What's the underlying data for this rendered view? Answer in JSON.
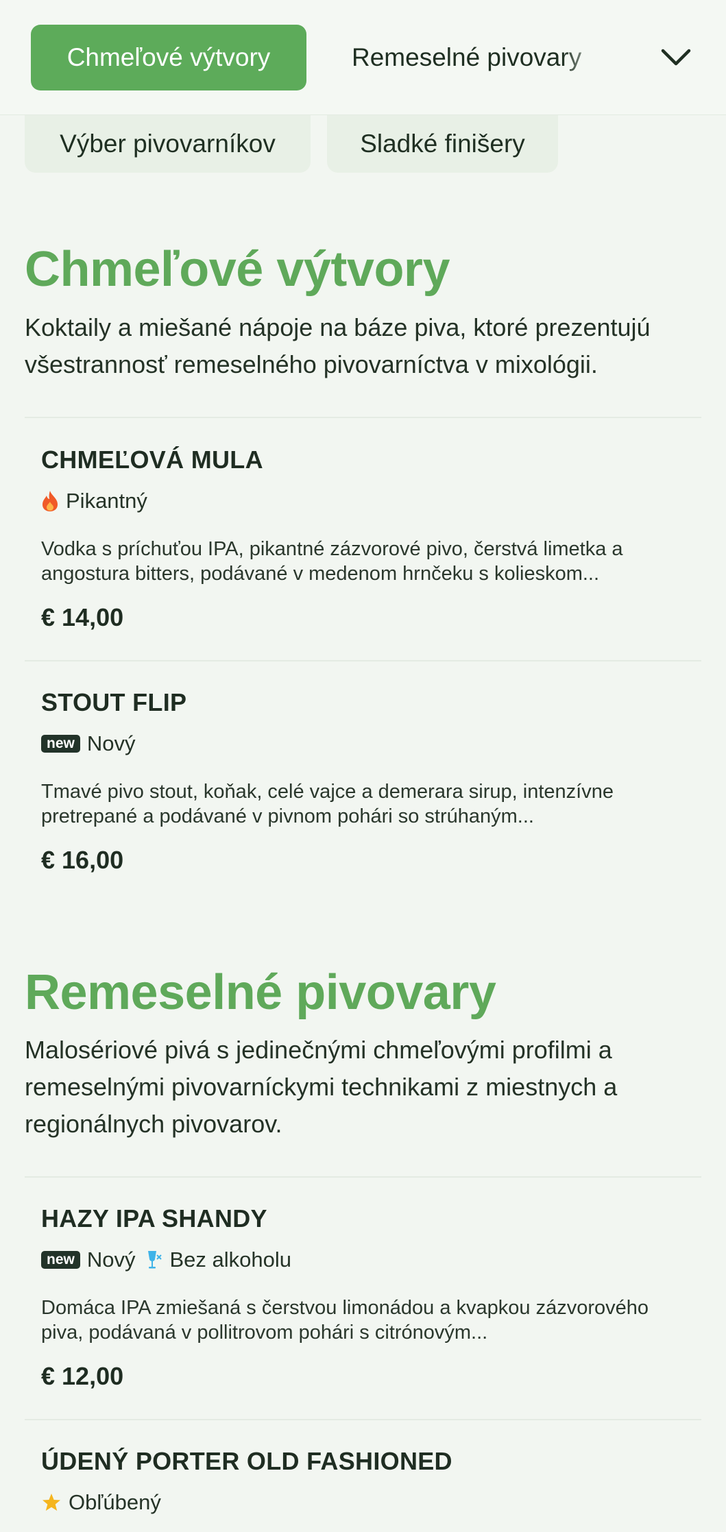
{
  "nav": {
    "active_tab": "Chmeľové výtvory",
    "next_tab": "Remeselné pivovary",
    "pills": [
      "Výber pivovarníkov",
      "Sladké finišery"
    ]
  },
  "sections": [
    {
      "title": "Chmeľové výtvory",
      "description": "Koktaily a miešané nápoje na báze piva, ktoré prezentujú všestrannosť remeselného pivovarníctva v mixológii.",
      "items": [
        {
          "name": "CHMEĽOVÁ MULA",
          "tags": [
            {
              "icon": "flame-icon",
              "label": "Pikantný"
            }
          ],
          "description": "Vodka s príchuťou IPA, pikantné zázvorové pivo, čerstvá limetka a angostura bitters, podávané v medenom hrnčeku s kolieskom...",
          "price": "€ 14,00"
        },
        {
          "name": "STOUT FLIP",
          "tags": [
            {
              "icon": "new-badge-icon",
              "badge": "new",
              "label": "Nový"
            }
          ],
          "description": "Tmavé pivo stout, koňak, celé vajce a demerara sirup, intenzívne pretrepané a podávané v pivnom pohári so strúhaným...",
          "price": "€ 16,00"
        }
      ]
    },
    {
      "title": "Remeselné pivovary",
      "description": "Malosériové pivá s jedinečnými chmeľovými profilmi a remeselnými pivovarníckymi technikami z miestnych a regionálnych pivovarov.",
      "items": [
        {
          "name": "HAZY IPA SHANDY",
          "tags": [
            {
              "icon": "new-badge-icon",
              "badge": "new",
              "label": "Nový"
            },
            {
              "icon": "no-alcohol-glass-icon",
              "label": "Bez alkoholu"
            }
          ],
          "description": "Domáca IPA zmiešaná s čerstvou limonádou a kvapkou zázvorového piva, podávaná v pollitrovom pohári s citrónovým...",
          "price": "€ 12,00"
        },
        {
          "name": "ÚDENÝ PORTER OLD FASHIONED",
          "tags": [
            {
              "icon": "star-icon",
              "label": "Obľúbený"
            }
          ]
        }
      ]
    }
  ],
  "colors": {
    "accent": "#5fa95a",
    "tab_active": "#5dab5a",
    "flame": "#f05a28",
    "no_alcohol": "#3fb3e8",
    "star": "#f5b51e"
  }
}
